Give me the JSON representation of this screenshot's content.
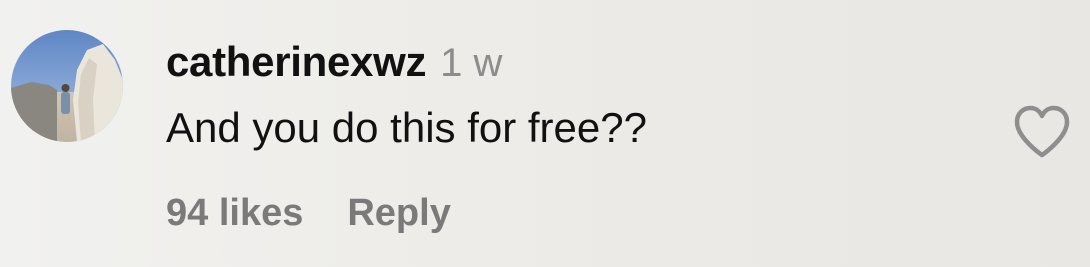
{
  "comment": {
    "username": "catherinexwz",
    "time": "1 w",
    "text": "And you do this for free??",
    "likes_label": "94 likes",
    "reply_label": "Reply"
  },
  "icons": {
    "like": "heart-outline-icon",
    "avatar": "profile-photo"
  },
  "colors": {
    "text_primary": "#111111",
    "text_secondary": "#7a7a7a",
    "timestamp": "#8c8c8c",
    "heart_outline": "#8e8e8e"
  }
}
